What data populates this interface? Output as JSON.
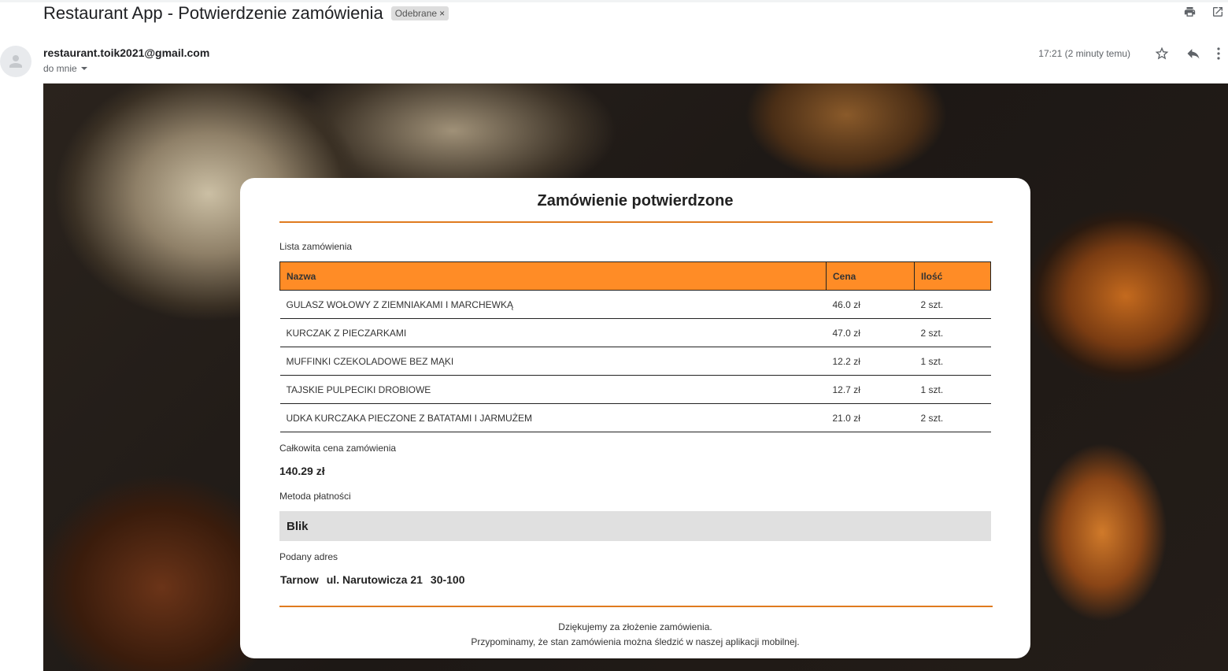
{
  "email": {
    "subject": "Restaurant App - Potwierdzenie zamówienia",
    "label_chip": "Odebrane",
    "label_chip_close": "×",
    "sender": "restaurant.toik2021@gmail.com",
    "recipient": "do mnie",
    "timestamp": "17:21 (2 minuty temu)",
    "icons": [
      "print-icon",
      "open-in-new-window-icon",
      "star-icon",
      "reply-icon",
      "more-options-icon",
      "avatar-person-icon",
      "chevron-down-icon"
    ]
  },
  "order": {
    "heading": "Zamówienie potwierdzone",
    "list_label": "Lista zamówienia",
    "columns": [
      "Nazwa",
      "Cena",
      "Ilość"
    ],
    "items": [
      {
        "name": "GULASZ WOŁOWY Z ZIEMNIAKAMI I MARCHEWKĄ",
        "price": "46.0 zł",
        "qty": "2 szt."
      },
      {
        "name": "KURCZAK Z PIECZARKAMI",
        "price": "47.0 zł",
        "qty": "2 szt."
      },
      {
        "name": "MUFFINKI CZEKOLADOWE BEZ MĄKI",
        "price": "12.2 zł",
        "qty": "1 szt."
      },
      {
        "name": "TAJSKIE PULPECIKI DROBIOWE",
        "price": "12.7 zł",
        "qty": "1 szt."
      },
      {
        "name": "UDKA KURCZAKA PIECZONE Z BATATAMI I JARMUŻEM",
        "price": "21.0 zł",
        "qty": "2 szt."
      }
    ],
    "total_label": "Całkowita cena zamówienia",
    "total_value": "140.29 zł",
    "payment_label": "Metoda płatności",
    "payment_value": "Blik",
    "address_label": "Podany adres",
    "address": {
      "city": "Tarnow",
      "street": "ul. Narutowicza 21",
      "postal": "30-100"
    },
    "thanks_line1": "Dziękujemy za złożenie zamówienia.",
    "thanks_line2": "Przypominamy, że stan zamówienia można śledzić w naszej aplikacji mobilnej."
  },
  "colors": {
    "accent": "#ff8c26",
    "rule": "#e07b1f",
    "payment_box": "#e0e0e0"
  }
}
